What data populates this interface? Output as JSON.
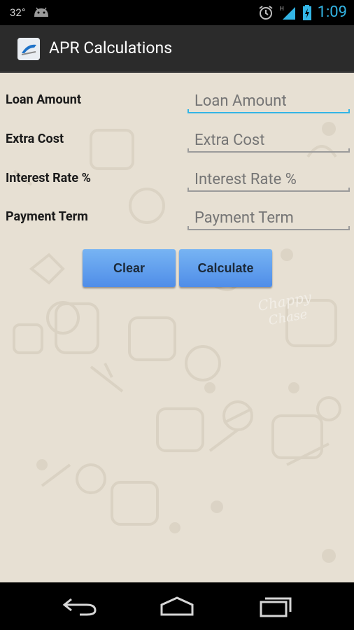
{
  "status_bar": {
    "temperature": "32°",
    "time": "1:09"
  },
  "app_bar": {
    "title": "APR Calculations"
  },
  "form": {
    "fields": [
      {
        "label": "Loan Amount",
        "placeholder": "Loan Amount",
        "value": ""
      },
      {
        "label": "Extra Cost",
        "placeholder": "Extra Cost",
        "value": ""
      },
      {
        "label": "Interest Rate %",
        "placeholder": "Interest Rate %",
        "value": ""
      },
      {
        "label": "Payment Term",
        "placeholder": "Payment Term",
        "value": ""
      }
    ],
    "buttons": {
      "clear": "Clear",
      "calculate": "Calculate"
    }
  },
  "colors": {
    "accent": "#33b5e5",
    "button": "#5d9bef",
    "background": "#e7e0d3"
  }
}
